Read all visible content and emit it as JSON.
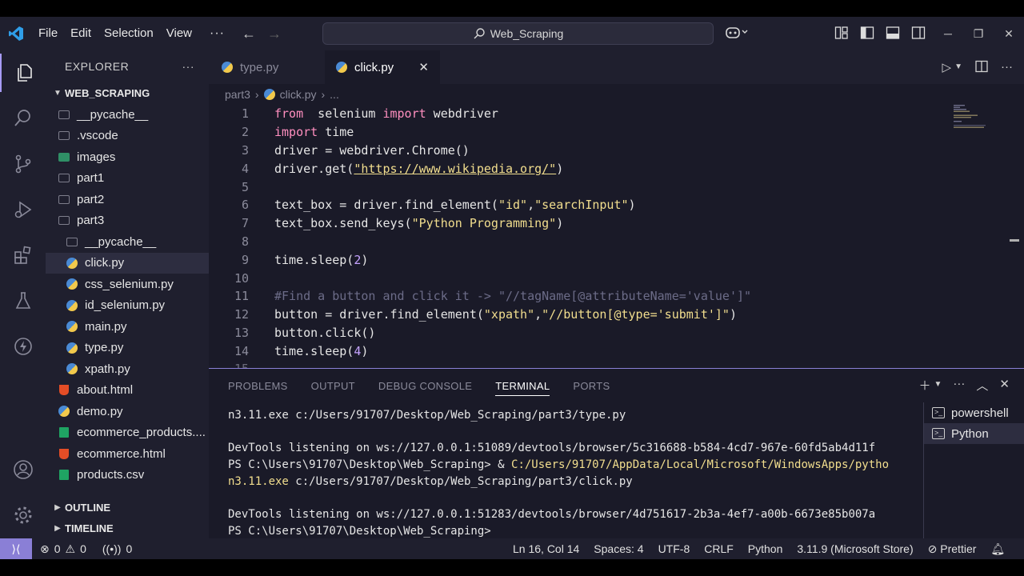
{
  "menu": {
    "file": "File",
    "edit": "Edit",
    "selection": "Selection",
    "view": "View",
    "more": "···"
  },
  "search": {
    "text": "Web_Scraping"
  },
  "explorer": {
    "title": "EXPLORER",
    "more": "···",
    "root": "WEB_SCRAPING",
    "items": [
      {
        "label": "__pycache__",
        "icon": "folder-icon",
        "indent": 1
      },
      {
        "label": ".vscode",
        "icon": "folder-icon",
        "indent": 1
      },
      {
        "label": "images",
        "icon": "image-folder-icon",
        "indent": 1
      },
      {
        "label": "part1",
        "icon": "folder-icon",
        "indent": 1
      },
      {
        "label": "part2",
        "icon": "folder-icon",
        "indent": 1
      },
      {
        "label": "part3",
        "icon": "folder-open-icon",
        "indent": 1
      },
      {
        "label": "__pycache__",
        "icon": "folder-icon",
        "indent": 2
      },
      {
        "label": "click.py",
        "icon": "python-icon",
        "indent": 2,
        "selected": true
      },
      {
        "label": "css_selenium.py",
        "icon": "python-icon",
        "indent": 2
      },
      {
        "label": "id_selenium.py",
        "icon": "python-icon",
        "indent": 2
      },
      {
        "label": "main.py",
        "icon": "python-icon",
        "indent": 2
      },
      {
        "label": "type.py",
        "icon": "python-icon",
        "indent": 2
      },
      {
        "label": "xpath.py",
        "icon": "python-icon",
        "indent": 2
      },
      {
        "label": "about.html",
        "icon": "html-icon",
        "indent": 1
      },
      {
        "label": "demo.py",
        "icon": "python-icon",
        "indent": 1
      },
      {
        "label": "ecommerce_products....",
        "icon": "csv-icon",
        "indent": 1
      },
      {
        "label": "ecommerce.html",
        "icon": "html-icon",
        "indent": 1
      },
      {
        "label": "products.csv",
        "icon": "csv-icon",
        "indent": 1
      }
    ],
    "outline": "OUTLINE",
    "timeline": "TIMELINE"
  },
  "tabs": [
    {
      "label": "type.py",
      "active": false
    },
    {
      "label": "click.py",
      "active": true
    }
  ],
  "breadcrumb": {
    "folder": "part3",
    "file": "click.py",
    "more": "..."
  },
  "code": [
    {
      "n": "1",
      "parts": [
        [
          "kw",
          "from"
        ],
        [
          "",
          "  selenium "
        ],
        [
          "kw",
          "import"
        ],
        [
          "",
          " webdriver"
        ]
      ]
    },
    {
      "n": "2",
      "parts": [
        [
          "kw",
          "import"
        ],
        [
          "",
          " time"
        ]
      ]
    },
    {
      "n": "3",
      "parts": [
        [
          "",
          "driver = webdriver.Chrome()"
        ]
      ]
    },
    {
      "n": "4",
      "parts": [
        [
          "",
          "driver.get("
        ],
        [
          "str url",
          "\"https://www.wikipedia.org/\""
        ],
        [
          "",
          ")"
        ]
      ]
    },
    {
      "n": "5",
      "parts": []
    },
    {
      "n": "6",
      "parts": [
        [
          "",
          "text_box = driver.find_element("
        ],
        [
          "str",
          "\"id\""
        ],
        [
          "",
          ","
        ],
        [
          "str",
          "\"searchInput\""
        ],
        [
          "",
          ")"
        ]
      ]
    },
    {
      "n": "7",
      "parts": [
        [
          "",
          "text_box.send_keys("
        ],
        [
          "str",
          "\"Python Programming\""
        ],
        [
          "",
          ")"
        ]
      ]
    },
    {
      "n": "8",
      "parts": []
    },
    {
      "n": "9",
      "parts": [
        [
          "",
          "time.sleep("
        ],
        [
          "num",
          "2"
        ],
        [
          "",
          ")"
        ]
      ]
    },
    {
      "n": "10",
      "parts": []
    },
    {
      "n": "11",
      "parts": [
        [
          "cmt",
          "#Find a button and click it -> \"//tagName[@attributeName='value']\""
        ]
      ]
    },
    {
      "n": "12",
      "parts": [
        [
          "",
          "button = driver.find_element("
        ],
        [
          "str",
          "\"xpath\""
        ],
        [
          "",
          ","
        ],
        [
          "str",
          "\"//button[@type='submit']\""
        ],
        [
          "",
          ")"
        ]
      ]
    },
    {
      "n": "13",
      "parts": [
        [
          "",
          "button.click()"
        ]
      ]
    },
    {
      "n": "14",
      "parts": [
        [
          "",
          "time.sleep("
        ],
        [
          "num",
          "4"
        ],
        [
          "",
          ")"
        ]
      ]
    }
  ],
  "panel": {
    "tabs": [
      "PROBLEMS",
      "OUTPUT",
      "DEBUG CONSOLE",
      "TERMINAL",
      "PORTS"
    ],
    "active_tab": "TERMINAL"
  },
  "terminal": {
    "lines": [
      [
        [
          "",
          "n3.11.exe c:/Users/91707/Desktop/Web_Scraping/part3/type.py"
        ]
      ],
      [],
      [
        [
          "",
          "DevTools listening on ws://127.0.0.1:51089/devtools/browser/5c316688-b584-4cd7-967e-60fd5ab4d11f"
        ]
      ],
      [
        [
          "",
          "PS C:\\Users\\91707\\Desktop\\Web_Scraping> & "
        ],
        [
          "tpath",
          "C:/Users/91707/AppData/Local/Microsoft/WindowsApps/pytho"
        ]
      ],
      [
        [
          "tpath",
          "n3.11.exe"
        ],
        [
          "",
          " c:/Users/91707/Desktop/Web_Scraping/part3/click.py"
        ]
      ],
      [],
      [
        [
          "",
          "DevTools listening on ws://127.0.0.1:51283/devtools/browser/4d751617-2b3a-4ef7-a00b-6673e85b007a"
        ]
      ],
      [
        [
          "",
          "PS C:\\Users\\91707\\Desktop\\Web_Scraping>"
        ]
      ]
    ],
    "instances": [
      {
        "label": "powershell",
        "selected": false
      },
      {
        "label": "Python",
        "selected": true
      }
    ]
  },
  "status": {
    "errors": "0",
    "warnings": "0",
    "ports": "0",
    "position": "Ln 16, Col 14",
    "spaces": "Spaces: 4",
    "encoding": "UTF-8",
    "eol": "CRLF",
    "language": "Python",
    "interpreter": "3.11.9 (Microsoft Store)",
    "prettier": "Prettier"
  },
  "colors": {
    "accent": "#8a7fd6",
    "keyword": "#ff8fbf",
    "string": "#f2de8e",
    "number": "#c5a3ff",
    "comment": "#6c6c88"
  }
}
